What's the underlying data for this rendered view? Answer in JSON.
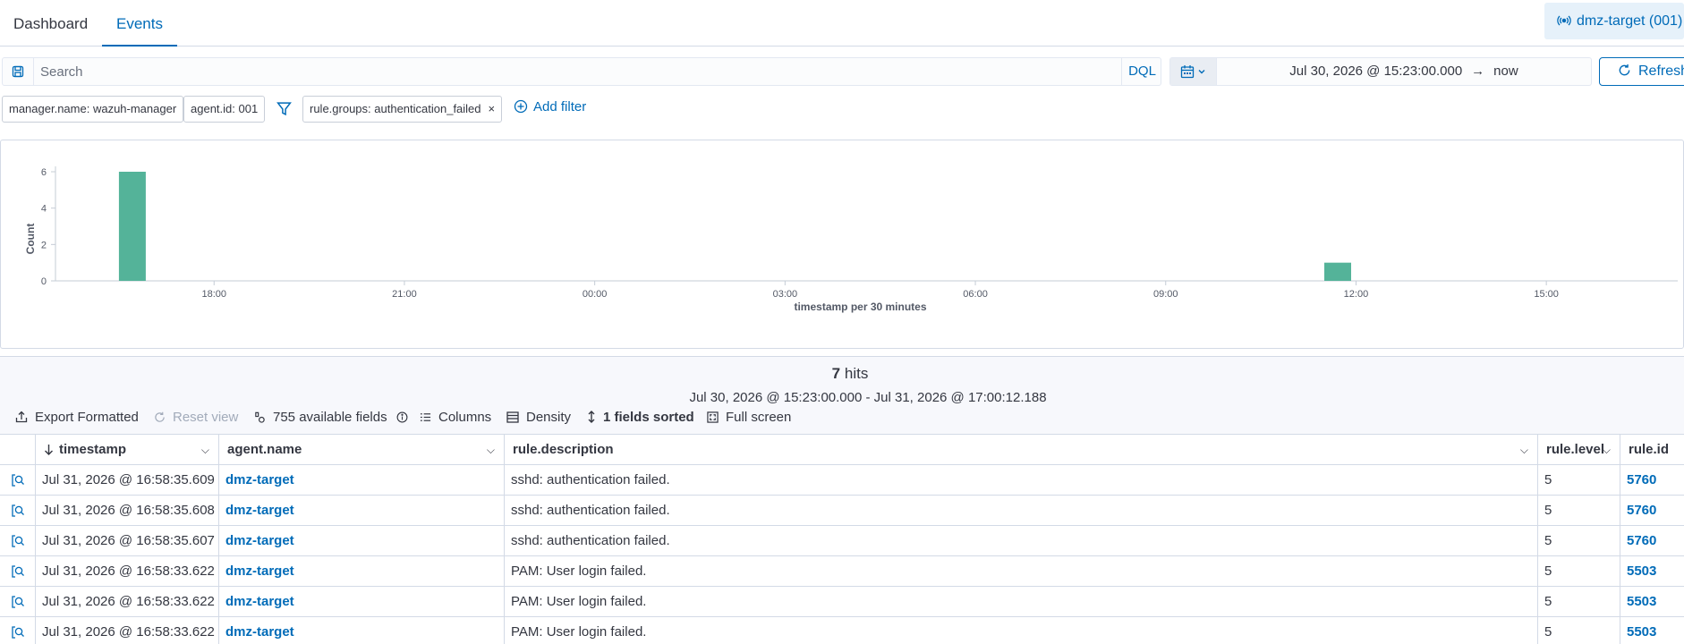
{
  "tabs": [
    {
      "label": "Dashboard"
    },
    {
      "label": "Events"
    }
  ],
  "agent_pill": {
    "label": "dmz-target (001)"
  },
  "search": {
    "placeholder": "Search",
    "language": "DQL"
  },
  "date_picker": {
    "start": "Jul 30, 2026 @ 15:23:00.000",
    "arrow": "→",
    "end": "now"
  },
  "refresh": {
    "label": "Refresh"
  },
  "filters": [
    {
      "label": "manager.name: wazuh-manager"
    },
    {
      "label": "agent.id: 001"
    },
    {
      "label": "rule.groups: authentication_failed",
      "close": "×"
    }
  ],
  "add_filter": {
    "label": "Add filter"
  },
  "chart_data": {
    "type": "bar",
    "xlabel": "timestamp per 30 minutes",
    "ylabel": "Count",
    "ylim": [
      0,
      6
    ],
    "yticks": [
      "0",
      "2",
      "4",
      "6"
    ],
    "xticks": [
      "18:00",
      "21:00",
      "00:00",
      "03:00",
      "06:00",
      "09:00",
      "12:00",
      "15:00"
    ],
    "bars": [
      {
        "x": "11:30",
        "value": 1
      },
      {
        "x": "16:30",
        "value": 6
      }
    ],
    "color": "#54b399",
    "grid": false
  },
  "results": {
    "hits_count": "7",
    "hits_label": "hits",
    "time_span": "Jul 30, 2026 @ 15:23:00.000 - Jul 31, 2026 @ 17:00:12.188"
  },
  "toolbar": {
    "export": "Export Formatted",
    "reset": "Reset view",
    "fields": "755 available fields",
    "columns": "Columns",
    "density": "Density",
    "sorted": "1 fields sorted",
    "fullscreen": "Full screen"
  },
  "table": {
    "columns": [
      "timestamp",
      "agent.name",
      "rule.description",
      "rule.level",
      "rule.id"
    ],
    "rows": [
      {
        "timestamp": "Jul 31, 2026 @ 16:58:35.609",
        "agent": "dmz-target",
        "description": "sshd: authentication failed.",
        "level": "5",
        "id": "5760"
      },
      {
        "timestamp": "Jul 31, 2026 @ 16:58:35.608",
        "agent": "dmz-target",
        "description": "sshd: authentication failed.",
        "level": "5",
        "id": "5760"
      },
      {
        "timestamp": "Jul 31, 2026 @ 16:58:35.607",
        "agent": "dmz-target",
        "description": "sshd: authentication failed.",
        "level": "5",
        "id": "5760"
      },
      {
        "timestamp": "Jul 31, 2026 @ 16:58:33.622",
        "agent": "dmz-target",
        "description": "PAM: User login failed.",
        "level": "5",
        "id": "5503"
      },
      {
        "timestamp": "Jul 31, 2026 @ 16:58:33.622",
        "agent": "dmz-target",
        "description": "PAM: User login failed.",
        "level": "5",
        "id": "5503"
      },
      {
        "timestamp": "Jul 31, 2026 @ 16:58:33.622",
        "agent": "dmz-target",
        "description": "PAM: User login failed.",
        "level": "5",
        "id": "5503"
      }
    ]
  },
  "colors": {
    "accent": "#006bb8",
    "bar": "#54b399",
    "border": "#d3dae6"
  }
}
